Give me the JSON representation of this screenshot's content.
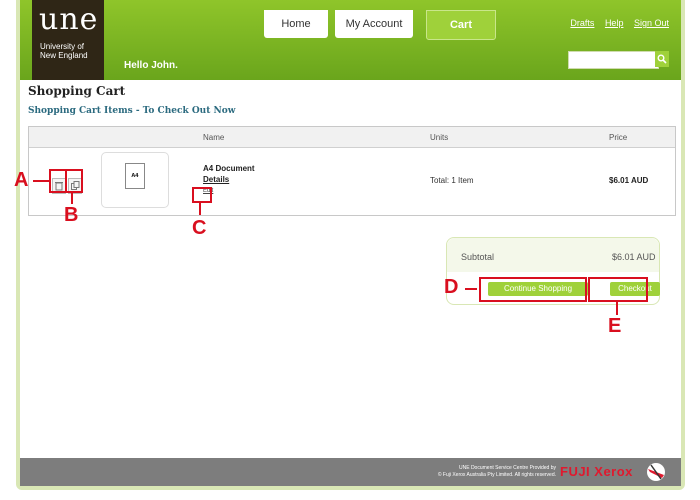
{
  "header": {
    "logo_text": "une",
    "logo_sub_line1": "University of",
    "logo_sub_line2": "New England",
    "greeting": "Hello John.",
    "tabs": [
      {
        "label": "Home"
      },
      {
        "label": "My Account"
      },
      {
        "label": "Cart"
      }
    ],
    "links": [
      "Drafts",
      "Help",
      "Sign Out"
    ],
    "search": {
      "value": "",
      "placeholder": ""
    },
    "search_icon": "search-icon"
  },
  "page": {
    "title": "Shopping Cart",
    "subtitle": "Shopping Cart Items - To Check Out Now"
  },
  "table": {
    "columns": [
      "Name",
      "Units",
      "Price"
    ],
    "rows": [
      {
        "thumb_label": "A4",
        "name": "A4 Document",
        "details_link": "Details",
        "edit_link": "Edit",
        "units": "Total: 1 Item",
        "price": "$6.01 AUD"
      }
    ]
  },
  "summary": {
    "subtotal_label": "Subtotal",
    "subtotal_value": "$6.01 AUD",
    "continue_label": "Continue Shopping",
    "checkout_label": "Checkout"
  },
  "footer": {
    "line1": "UNE Document Service Centre Provided by",
    "line2": "© Fuji Xerox Australia Pty Limited. All rights reserved.",
    "brand": "FUJI Xerox"
  },
  "annotations": [
    "A",
    "B",
    "C",
    "D",
    "E"
  ],
  "colors": {
    "accent_green": "#7ab526",
    "button_green": "#9fd13a",
    "annotation_red": "#d90f1f",
    "heading_teal": "#2b6a7f"
  }
}
